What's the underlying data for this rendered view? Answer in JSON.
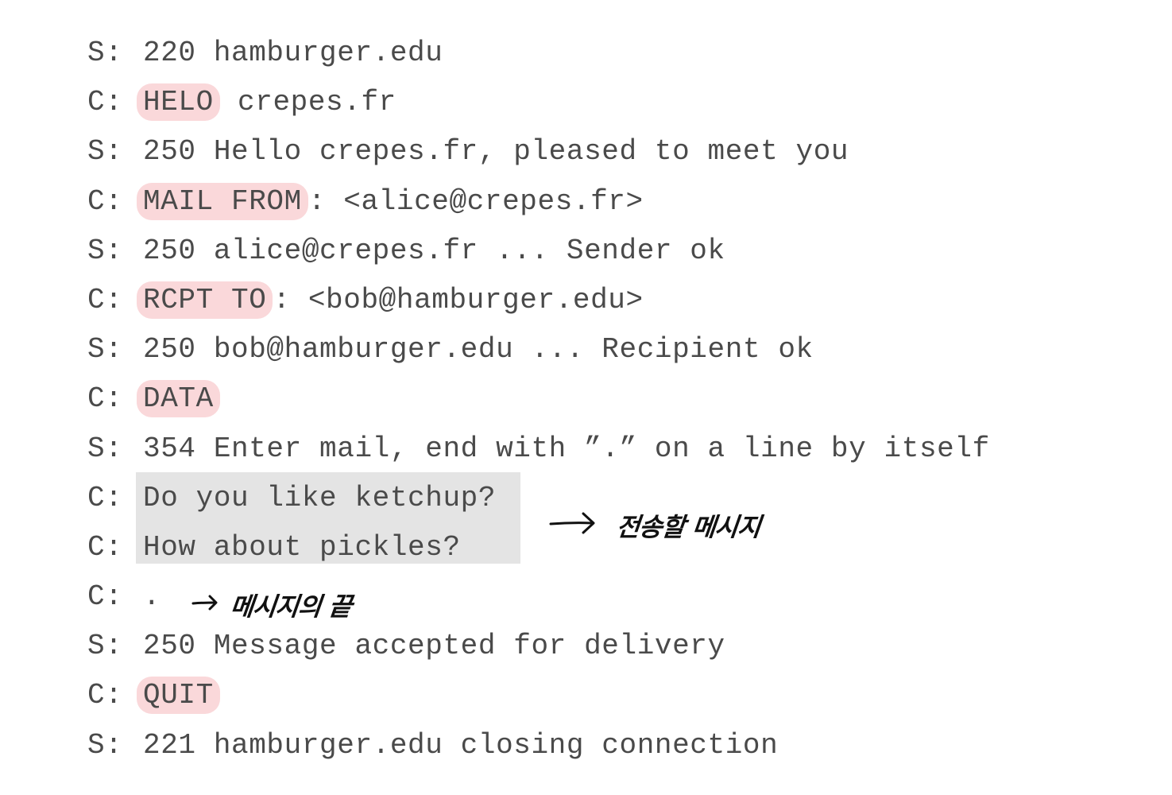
{
  "transcript": {
    "lines": [
      {
        "who": "S:",
        "cmd": "",
        "text": "220 hamburger.edu"
      },
      {
        "who": "C:",
        "cmd": "HELO",
        "text": " crepes.fr"
      },
      {
        "who": "S:",
        "cmd": "",
        "text": "250 Hello crepes.fr, pleased to meet you"
      },
      {
        "who": "C:",
        "cmd": "MAIL FROM",
        "text": ": <alice@crepes.fr>"
      },
      {
        "who": "S:",
        "cmd": "",
        "text": "250 alice@crepes.fr ... Sender ok"
      },
      {
        "who": "C:",
        "cmd": "RCPT TO",
        "text": ": <bob@hamburger.edu>"
      },
      {
        "who": "S:",
        "cmd": "",
        "text": "250 bob@hamburger.edu ... Recipient ok"
      },
      {
        "who": "C:",
        "cmd": "DATA",
        "text": ""
      },
      {
        "who": "S:",
        "cmd": "",
        "text": "354 Enter mail, end with ”.” on a line by itself"
      },
      {
        "who": "C:",
        "cmd": "",
        "text": "Do you like ketchup?"
      },
      {
        "who": "C:",
        "cmd": "",
        "text": "How about pickles?"
      },
      {
        "who": "C:",
        "cmd": "",
        "text": "."
      },
      {
        "who": "S:",
        "cmd": "",
        "text": "250 Message accepted for delivery"
      },
      {
        "who": "C:",
        "cmd": "QUIT",
        "text": ""
      },
      {
        "who": "S:",
        "cmd": "",
        "text": "221 hamburger.edu closing connection"
      }
    ]
  },
  "annotations": {
    "message_note": "전송할 메시지",
    "end_note": "메시지의 끝"
  },
  "colors": {
    "command_highlight": "#fad8da",
    "message_box": "#e4e4e4",
    "text": "#4a4a4a",
    "handwriting": "#111111"
  }
}
